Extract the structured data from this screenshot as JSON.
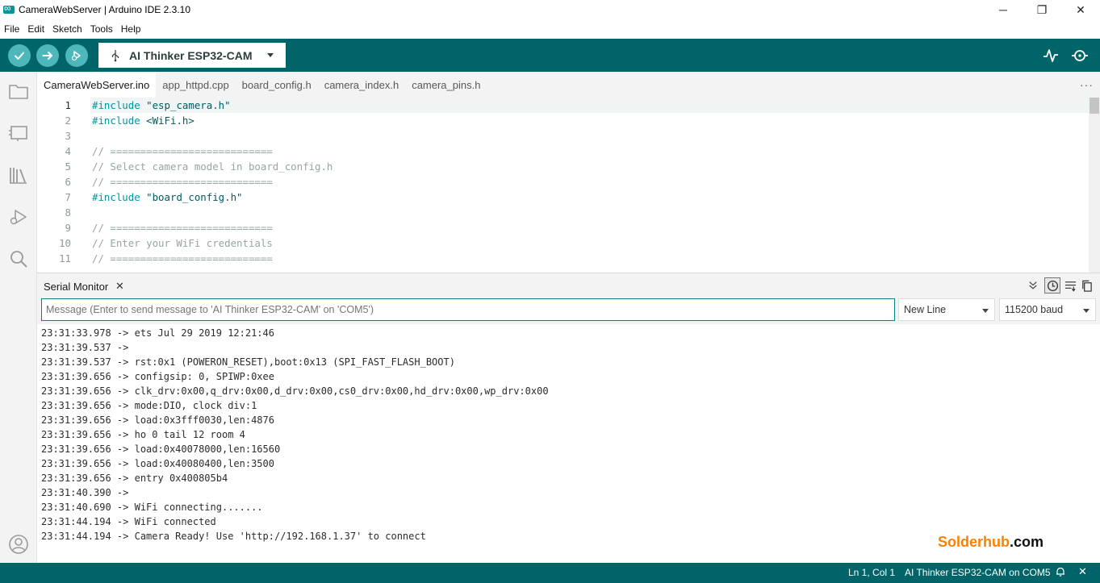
{
  "window": {
    "title": "CameraWebServer | Arduino IDE 2.3.10",
    "minimize": "─",
    "maximize": "❐",
    "close": "✕"
  },
  "menu": [
    "File",
    "Edit",
    "Sketch",
    "Tools",
    "Help"
  ],
  "toolbar": {
    "board": "AI Thinker ESP32-CAM"
  },
  "tabs": [
    "CameraWebServer.ino",
    "app_httpd.cpp",
    "board_config.h",
    "camera_index.h",
    "camera_pins.h"
  ],
  "tabs_more": "···",
  "editor": {
    "lines": [
      {
        "n": "1",
        "text": "#include \"esp_camera.h\"",
        "kind": "pre"
      },
      {
        "n": "2",
        "text": "#include <WiFi.h>",
        "kind": "pre"
      },
      {
        "n": "3",
        "text": "",
        "kind": "plain"
      },
      {
        "n": "4",
        "text": "// ===========================",
        "kind": "cmt"
      },
      {
        "n": "5",
        "text": "// Select camera model in board_config.h",
        "kind": "cmt"
      },
      {
        "n": "6",
        "text": "// ===========================",
        "kind": "cmt"
      },
      {
        "n": "7",
        "text": "#include \"board_config.h\"",
        "kind": "pre"
      },
      {
        "n": "8",
        "text": "",
        "kind": "plain"
      },
      {
        "n": "9",
        "text": "// ===========================",
        "kind": "cmt"
      },
      {
        "n": "10",
        "text": "// Enter your WiFi credentials",
        "kind": "cmt"
      },
      {
        "n": "11",
        "text": "// ===========================",
        "kind": "cmt"
      }
    ]
  },
  "serial": {
    "title": "Serial Monitor",
    "close": "✕",
    "placeholder": "Message (Enter to send message to 'AI Thinker ESP32-CAM' on 'COM5')",
    "line_ending": "New Line",
    "baud": "115200 baud",
    "output": [
      "23:31:33.978 -> ets Jul 29 2019 12:21:46",
      "23:31:39.537 -> ",
      "23:31:39.537 -> rst:0x1 (POWERON_RESET),boot:0x13 (SPI_FAST_FLASH_BOOT)",
      "23:31:39.656 -> configsip: 0, SPIWP:0xee",
      "23:31:39.656 -> clk_drv:0x00,q_drv:0x00,d_drv:0x00,cs0_drv:0x00,hd_drv:0x00,wp_drv:0x00",
      "23:31:39.656 -> mode:DIO, clock div:1",
      "23:31:39.656 -> load:0x3fff0030,len:4876",
      "23:31:39.656 -> ho 0 tail 12 room 4",
      "23:31:39.656 -> load:0x40078000,len:16560",
      "23:31:39.656 -> load:0x40080400,len:3500",
      "23:31:39.656 -> entry 0x400805b4",
      "23:31:40.390 -> ",
      "23:31:40.690 -> WiFi connecting.......",
      "23:31:44.194 -> WiFi connected",
      "23:31:44.194 -> Camera Ready! Use 'http://192.168.1.37' to connect"
    ]
  },
  "watermark": {
    "part1": "Solderhub",
    "part2": ".com"
  },
  "status": {
    "position": "Ln 1, Col 1",
    "board": "AI Thinker ESP32-CAM on COM5",
    "close": "✕"
  },
  "colors": {
    "teal_dark": "#006468",
    "teal_light": "#4db7bb",
    "accent": "#00979d"
  }
}
